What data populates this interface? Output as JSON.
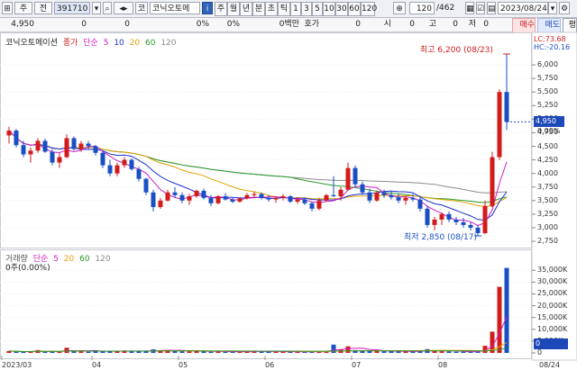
{
  "toolbar": {
    "b1": "주",
    "b2": "전",
    "code": "391710",
    "name_prefix": "코",
    "name": "코닉오토메",
    "info": "i",
    "periods": [
      "주",
      "월",
      "년",
      "분",
      "초",
      "틱",
      "1",
      "3",
      "5",
      "10",
      "30",
      "60",
      "120"
    ],
    "count": "120",
    "total": "/462",
    "date": "2023/08/24",
    "buy": "매수",
    "sell": "매도",
    "more": "평"
  },
  "quote": {
    "price": "4,950",
    "v1": "0",
    "v2": "0",
    "p1": "0%",
    "p2": "0%",
    "amount": "0백만",
    "hoga": "호가",
    "v3": "0",
    "open_label": "시",
    "open": "0",
    "high_label": "고",
    "high": "0",
    "low_label": "저",
    "low": "0"
  },
  "price_legend": {
    "name": "코닉오토메이션",
    "type": "종가",
    "ma": "단순",
    "periods": [
      "5",
      "10",
      "20",
      "60",
      "120"
    ]
  },
  "volume_legend": {
    "name": "거래량",
    "ma": "단순",
    "periods": [
      "5",
      "20",
      "60",
      "120"
    ],
    "current": "0주(0.00%)"
  },
  "price_axis": {
    "ticks": [
      "6,000",
      "5,750",
      "5,500",
      "5,250",
      "5,000",
      "4,750",
      "4,500",
      "4,250",
      "4,000",
      "3,750",
      "3,500",
      "3,250",
      "3,000",
      "2,750"
    ],
    "lc": "LC:73.68",
    "hc": "HC:-20.16",
    "current": "4,950",
    "change": "0.00%"
  },
  "volume_axis": {
    "ticks": [
      "35,000K",
      "30,000K",
      "25,000K",
      "20,000K",
      "15,000K",
      "10,000K",
      "5,000K",
      "0"
    ],
    "current": "0"
  },
  "annotations": {
    "high": "최고 6,200 (08/23)",
    "low": "최저 2,850 (08/17)"
  },
  "x_axis": {
    "labels": [
      "2023/03",
      "04",
      "05",
      "06",
      "07",
      "08",
      "08/24"
    ]
  },
  "colors": {
    "up": "#d21c1c",
    "down": "#1a4fc4",
    "ma5": "#d01bc8",
    "ma10": "#1e2fd6",
    "ma20": "#e4a300",
    "ma60": "#2a9a2a",
    "ma120": "#8c8c8c"
  },
  "chart_data": {
    "type": "candlestick",
    "price_range": [
      2750,
      6250
    ],
    "volume_range": [
      0,
      37000
    ],
    "volume_unit": "K",
    "candles": [
      {
        "date": "2023/03 w1",
        "o": 4700,
        "h": 4860,
        "l": 4550,
        "c": 4790
      },
      {
        "date": "2023/03 w1",
        "o": 4790,
        "h": 4820,
        "l": 4480,
        "c": 4520
      },
      {
        "date": "2023/03 w1",
        "o": 4520,
        "h": 4600,
        "l": 4300,
        "c": 4350
      },
      {
        "date": "2023/03 w2",
        "o": 4350,
        "h": 4480,
        "l": 4200,
        "c": 4420
      },
      {
        "date": "2023/03 w2",
        "o": 4420,
        "h": 4650,
        "l": 4380,
        "c": 4600
      },
      {
        "date": "2023/03 w2",
        "o": 4600,
        "h": 4640,
        "l": 4380,
        "c": 4400
      },
      {
        "date": "2023/03 w3",
        "o": 4400,
        "h": 4450,
        "l": 4150,
        "c": 4200
      },
      {
        "date": "2023/03 w3",
        "o": 4200,
        "h": 4380,
        "l": 4100,
        "c": 4300
      },
      {
        "date": "2023/03 w3",
        "o": 4300,
        "h": 4720,
        "l": 4280,
        "c": 4650
      },
      {
        "date": "2023/03 w4",
        "o": 4650,
        "h": 4680,
        "l": 4420,
        "c": 4450
      },
      {
        "date": "2023/03 w4",
        "o": 4450,
        "h": 4600,
        "l": 4400,
        "c": 4550
      },
      {
        "date": "2023/03 w4",
        "o": 4550,
        "h": 4600,
        "l": 4450,
        "c": 4500
      },
      {
        "date": "2023/04 w1",
        "o": 4500,
        "h": 4520,
        "l": 4330,
        "c": 4380
      },
      {
        "date": "2023/04 w1",
        "o": 4380,
        "h": 4420,
        "l": 4100,
        "c": 4150
      },
      {
        "date": "2023/04 w1",
        "o": 4150,
        "h": 4250,
        "l": 3950,
        "c": 4000
      },
      {
        "date": "2023/04 w2",
        "o": 4000,
        "h": 4200,
        "l": 3950,
        "c": 4150
      },
      {
        "date": "2023/04 w2",
        "o": 4150,
        "h": 4300,
        "l": 4100,
        "c": 4250
      },
      {
        "date": "2023/04 w2",
        "o": 4250,
        "h": 4280,
        "l": 4050,
        "c": 4080
      },
      {
        "date": "2023/04 w3",
        "o": 4080,
        "h": 4120,
        "l": 3850,
        "c": 3900
      },
      {
        "date": "2023/04 w3",
        "o": 3900,
        "h": 3920,
        "l": 3600,
        "c": 3650
      },
      {
        "date": "2023/04 w3",
        "o": 3650,
        "h": 3700,
        "l": 3300,
        "c": 3380
      },
      {
        "date": "2023/04 w4",
        "o": 3380,
        "h": 3550,
        "l": 3350,
        "c": 3500
      },
      {
        "date": "2023/04 w4",
        "o": 3500,
        "h": 3700,
        "l": 3480,
        "c": 3650
      },
      {
        "date": "2023/04 w4",
        "o": 3650,
        "h": 3750,
        "l": 3550,
        "c": 3600
      },
      {
        "date": "2023/05 w1",
        "o": 3600,
        "h": 3650,
        "l": 3450,
        "c": 3500
      },
      {
        "date": "2023/05 w1",
        "o": 3500,
        "h": 3620,
        "l": 3420,
        "c": 3580
      },
      {
        "date": "2023/05 w1",
        "o": 3580,
        "h": 3700,
        "l": 3550,
        "c": 3680
      },
      {
        "date": "2023/05 w2",
        "o": 3680,
        "h": 3720,
        "l": 3520,
        "c": 3550
      },
      {
        "date": "2023/05 w2",
        "o": 3550,
        "h": 3600,
        "l": 3400,
        "c": 3450
      },
      {
        "date": "2023/05 w2",
        "o": 3450,
        "h": 3600,
        "l": 3430,
        "c": 3580
      },
      {
        "date": "2023/05 w3",
        "o": 3580,
        "h": 3640,
        "l": 3500,
        "c": 3520
      },
      {
        "date": "2023/05 w3",
        "o": 3520,
        "h": 3560,
        "l": 3450,
        "c": 3480
      },
      {
        "date": "2023/05 w3",
        "o": 3480,
        "h": 3560,
        "l": 3460,
        "c": 3540
      },
      {
        "date": "2023/05 w4",
        "o": 3540,
        "h": 3640,
        "l": 3520,
        "c": 3600
      },
      {
        "date": "2023/05 w4",
        "o": 3600,
        "h": 3660,
        "l": 3560,
        "c": 3620
      },
      {
        "date": "2023/05 w4",
        "o": 3620,
        "h": 3650,
        "l": 3520,
        "c": 3550
      },
      {
        "date": "2023/06 w1",
        "o": 3550,
        "h": 3600,
        "l": 3480,
        "c": 3520
      },
      {
        "date": "2023/06 w1",
        "o": 3520,
        "h": 3580,
        "l": 3460,
        "c": 3550
      },
      {
        "date": "2023/06 w1",
        "o": 3550,
        "h": 3620,
        "l": 3500,
        "c": 3580
      },
      {
        "date": "2023/06 w2",
        "o": 3580,
        "h": 3600,
        "l": 3450,
        "c": 3480
      },
      {
        "date": "2023/06 w2",
        "o": 3480,
        "h": 3560,
        "l": 3440,
        "c": 3520
      },
      {
        "date": "2023/06 w2",
        "o": 3520,
        "h": 3560,
        "l": 3420,
        "c": 3450
      },
      {
        "date": "2023/06 w3",
        "o": 3450,
        "h": 3480,
        "l": 3300,
        "c": 3350
      },
      {
        "date": "2023/06 w3",
        "o": 3350,
        "h": 3550,
        "l": 3320,
        "c": 3500
      },
      {
        "date": "2023/06 w3",
        "o": 3500,
        "h": 3620,
        "l": 3480,
        "c": 3600
      },
      {
        "date": "2023/06 w4",
        "o": 3600,
        "h": 3950,
        "l": 3560,
        "c": 3580
      },
      {
        "date": "2023/06 w4",
        "o": 3580,
        "h": 3750,
        "l": 3500,
        "c": 3700
      },
      {
        "date": "2023/06 w4",
        "o": 3700,
        "h": 4200,
        "l": 3680,
        "c": 4100
      },
      {
        "date": "2023/07 w1",
        "o": 4100,
        "h": 4150,
        "l": 3750,
        "c": 3800
      },
      {
        "date": "2023/07 w1",
        "o": 3800,
        "h": 3850,
        "l": 3600,
        "c": 3650
      },
      {
        "date": "2023/07 w1",
        "o": 3650,
        "h": 3720,
        "l": 3450,
        "c": 3500
      },
      {
        "date": "2023/07 w2",
        "o": 3500,
        "h": 3680,
        "l": 3480,
        "c": 3650
      },
      {
        "date": "2023/07 w2",
        "o": 3650,
        "h": 3700,
        "l": 3550,
        "c": 3600
      },
      {
        "date": "2023/07 w2",
        "o": 3600,
        "h": 3680,
        "l": 3520,
        "c": 3560
      },
      {
        "date": "2023/07 w3",
        "o": 3560,
        "h": 3620,
        "l": 3450,
        "c": 3500
      },
      {
        "date": "2023/07 w3",
        "o": 3500,
        "h": 3580,
        "l": 3420,
        "c": 3550
      },
      {
        "date": "2023/07 w3",
        "o": 3550,
        "h": 3620,
        "l": 3480,
        "c": 3520
      },
      {
        "date": "2023/07 w4",
        "o": 3520,
        "h": 3580,
        "l": 3300,
        "c": 3350
      },
      {
        "date": "2023/07 w4",
        "o": 3350,
        "h": 3400,
        "l": 3000,
        "c": 3050
      },
      {
        "date": "2023/07 w4",
        "o": 3050,
        "h": 3200,
        "l": 2950,
        "c": 3150
      },
      {
        "date": "2023/08 w1",
        "o": 3150,
        "h": 3280,
        "l": 3050,
        "c": 3250
      },
      {
        "date": "2023/08 w1",
        "o": 3250,
        "h": 3300,
        "l": 3100,
        "c": 3150
      },
      {
        "date": "2023/08 w1",
        "o": 3150,
        "h": 3200,
        "l": 3050,
        "c": 3100
      },
      {
        "date": "2023/08 w2",
        "o": 3100,
        "h": 3180,
        "l": 3000,
        "c": 3050
      },
      {
        "date": "2023/08 w2",
        "o": 3050,
        "h": 3100,
        "l": 2950,
        "c": 3000
      },
      {
        "date": "2023/08 w2",
        "o": 3000,
        "h": 3050,
        "l": 2850,
        "c": 2900
      },
      {
        "date": "2023/08 w3",
        "o": 2900,
        "h": 3500,
        "l": 2880,
        "c": 3400
      },
      {
        "date": "2023/08 w3",
        "o": 3400,
        "h": 4400,
        "l": 3380,
        "c": 4300
      },
      {
        "date": "2023/08 w3",
        "o": 4300,
        "h": 5550,
        "l": 4250,
        "c": 5500
      },
      {
        "date": "2023/08/24",
        "o": 5500,
        "h": 6200,
        "l": 4800,
        "c": 4950
      }
    ],
    "volume": [
      800,
      500,
      400,
      600,
      1200,
      500,
      600,
      400,
      2200,
      900,
      600,
      500,
      700,
      800,
      900,
      700,
      1000,
      600,
      800,
      900,
      1500,
      1100,
      1300,
      800,
      700,
      700,
      900,
      600,
      500,
      600,
      500,
      500,
      600,
      700,
      800,
      500,
      500,
      500,
      600,
      500,
      500,
      400,
      600,
      700,
      800,
      3500,
      1500,
      2800,
      1200,
      900,
      800,
      900,
      700,
      600,
      600,
      700,
      600,
      800,
      1600,
      900,
      700,
      600,
      500,
      500,
      400,
      700,
      3000,
      9000,
      28000,
      36000
    ]
  }
}
